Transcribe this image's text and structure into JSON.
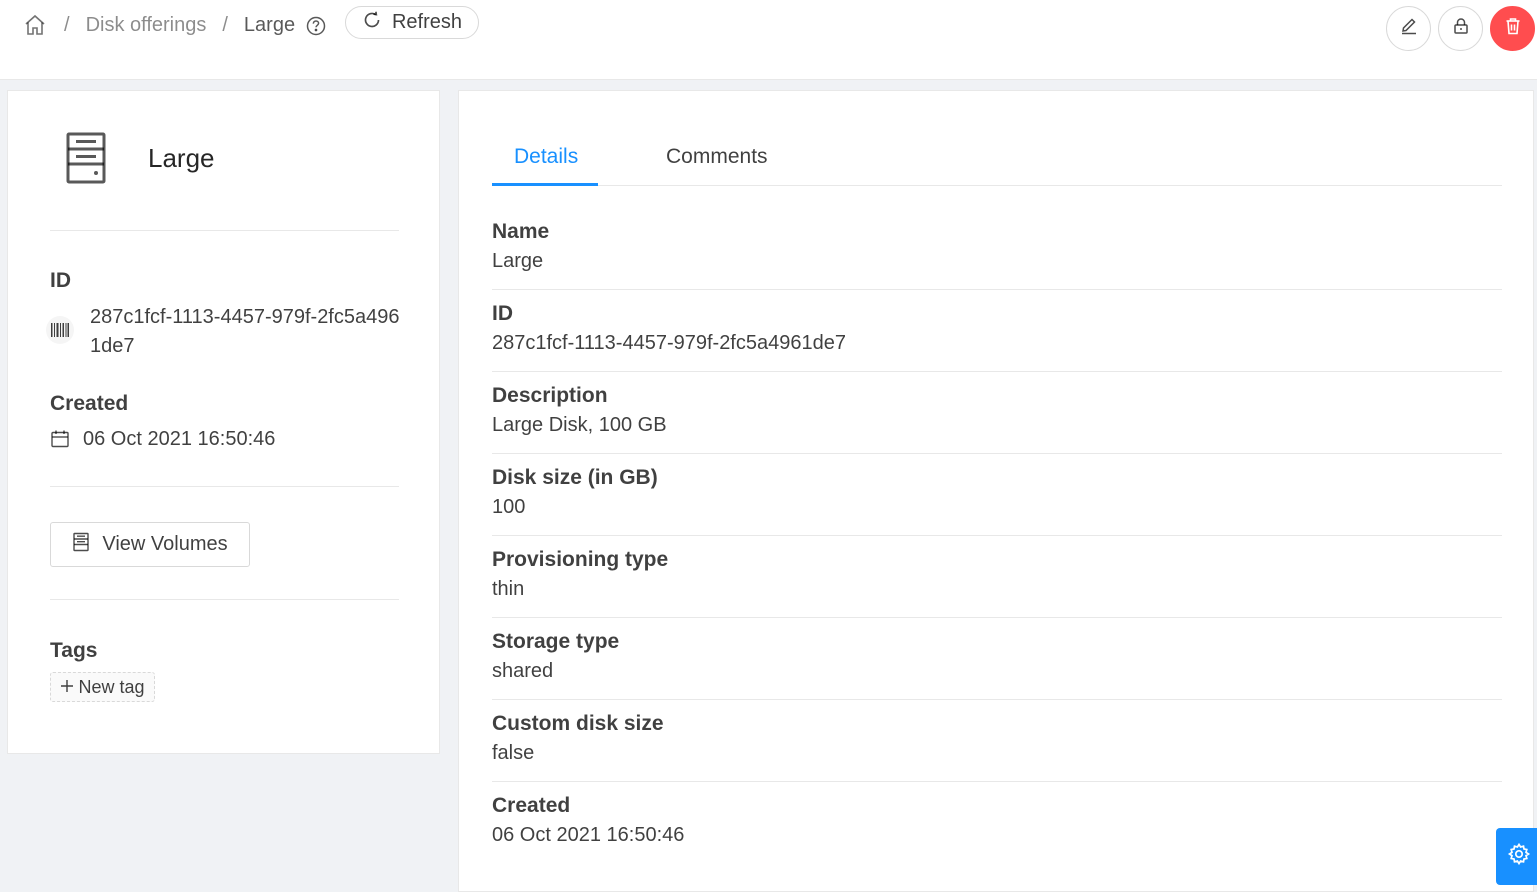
{
  "breadcrumb": {
    "home_icon": "home-icon",
    "parent": "Disk offerings",
    "current": "Large",
    "separator": "/"
  },
  "toolbar": {
    "refresh_label": "Refresh",
    "actions": [
      "edit-icon",
      "lock-icon",
      "delete-icon"
    ]
  },
  "resource": {
    "name": "Large",
    "id_label": "ID",
    "id_value": "287c1fcf-1113-4457-979f-2fc5a4961de7",
    "created_label": "Created",
    "created_value": "06 Oct 2021 16:50:46",
    "view_volumes_label": "View Volumes",
    "tags_label": "Tags",
    "new_tag_label": "New tag"
  },
  "tabs": [
    {
      "label": "Details",
      "active": true
    },
    {
      "label": "Comments",
      "active": false
    }
  ],
  "details": [
    {
      "label": "Name",
      "value": "Large"
    },
    {
      "label": "ID",
      "value": "287c1fcf-1113-4457-979f-2fc5a4961de7"
    },
    {
      "label": "Description",
      "value": "Large Disk, 100 GB"
    },
    {
      "label": "Disk size (in GB)",
      "value": "100"
    },
    {
      "label": "Provisioning type",
      "value": "thin"
    },
    {
      "label": "Storage type",
      "value": "shared"
    },
    {
      "label": "Custom disk size",
      "value": "false"
    },
    {
      "label": "Created",
      "value": "06 Oct 2021 16:50:46"
    }
  ],
  "colors": {
    "primary": "#1890ff",
    "danger": "#ff4d4f",
    "background": "#f0f2f5"
  }
}
